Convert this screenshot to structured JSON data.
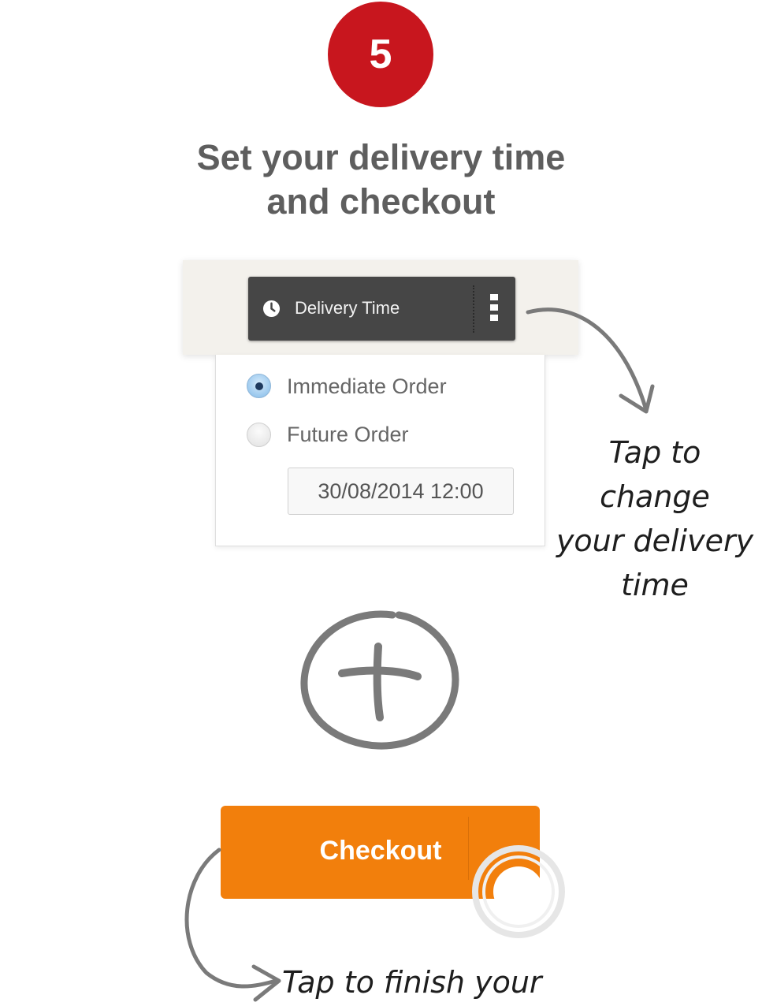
{
  "step": {
    "number": "5"
  },
  "heading": {
    "line1": "Set your delivery time",
    "line2": "and checkout"
  },
  "delivery_button": {
    "label": "Delivery Time",
    "icon": "clock-icon",
    "menu_icon": "kebab-menu-icon"
  },
  "order_options": {
    "immediate": {
      "label": "Immediate Order",
      "selected": true
    },
    "future": {
      "label": "Future Order",
      "selected": false
    },
    "datetime_value": "30/08/2014 12:00"
  },
  "hints": {
    "change_line1": "Tap to change",
    "change_line2": "your delivery",
    "change_line3": "time",
    "finish": "Tap to finish your order"
  },
  "plus_icon": "plus-circle-icon",
  "checkout": {
    "label": "Checkout"
  },
  "colors": {
    "badge": "#c8161e",
    "heading": "#5e5e5e",
    "delivery_button": "#464646",
    "checkout": "#f27f0c",
    "sketch": "#7a7a7a"
  }
}
